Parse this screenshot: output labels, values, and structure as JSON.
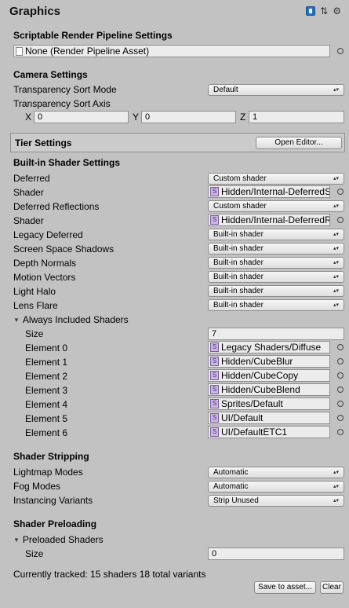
{
  "window": {
    "title": "Graphics",
    "icons": [
      "book-icon",
      "sliders-icon",
      "gear-icon"
    ]
  },
  "srp": {
    "section": "Scriptable Render Pipeline Settings",
    "value": "None (Render Pipeline Asset)"
  },
  "camera": {
    "section": "Camera Settings",
    "sort_mode_label": "Transparency Sort Mode",
    "sort_mode_value": "Default",
    "sort_axis_label": "Transparency Sort Axis",
    "x_label": "X",
    "x_value": "0",
    "y_label": "Y",
    "y_value": "0",
    "z_label": "Z",
    "z_value": "1"
  },
  "tier": {
    "label": "Tier Settings",
    "button": "Open Editor..."
  },
  "builtin": {
    "section": "Built-in Shader Settings",
    "rows": [
      {
        "label": "Deferred",
        "value": "Custom shader"
      },
      {
        "label": "Shader",
        "value": "Hidden/Internal-DeferredS"
      },
      {
        "label": "Deferred Reflections",
        "value": "Custom shader"
      },
      {
        "label": "Shader",
        "value": "Hidden/Internal-DeferredR"
      },
      {
        "label": "Legacy Deferred",
        "value": "Built-in shader"
      },
      {
        "label": "Screen Space Shadows",
        "value": "Built-in shader"
      },
      {
        "label": "Depth Normals",
        "value": "Built-in shader"
      },
      {
        "label": "Motion Vectors",
        "value": "Built-in shader"
      },
      {
        "label": "Light Halo",
        "value": "Built-in shader"
      },
      {
        "label": "Lens Flare",
        "value": "Built-in shader"
      }
    ]
  },
  "always_included": {
    "label": "Always Included Shaders",
    "size_label": "Size",
    "size_value": "7",
    "elements": [
      {
        "label": "Element 0",
        "value": "Legacy Shaders/Diffuse"
      },
      {
        "label": "Element 1",
        "value": "Hidden/CubeBlur"
      },
      {
        "label": "Element 2",
        "value": "Hidden/CubeCopy"
      },
      {
        "label": "Element 3",
        "value": "Hidden/CubeBlend"
      },
      {
        "label": "Element 4",
        "value": "Sprites/Default"
      },
      {
        "label": "Element 5",
        "value": "UI/Default"
      },
      {
        "label": "Element 6",
        "value": "UI/DefaultETC1"
      }
    ]
  },
  "stripping": {
    "section": "Shader Stripping",
    "rows": [
      {
        "label": "Lightmap Modes",
        "value": "Automatic"
      },
      {
        "label": "Fog Modes",
        "value": "Automatic"
      },
      {
        "label": "Instancing Variants",
        "value": "Strip Unused"
      }
    ]
  },
  "preloading": {
    "section": "Shader Preloading",
    "preloaded_label": "Preloaded Shaders",
    "size_label": "Size",
    "size_value": "0",
    "tracked": "Currently tracked: 15 shaders 18 total variants",
    "save_button": "Save to asset...",
    "clear_button": "Clear"
  }
}
